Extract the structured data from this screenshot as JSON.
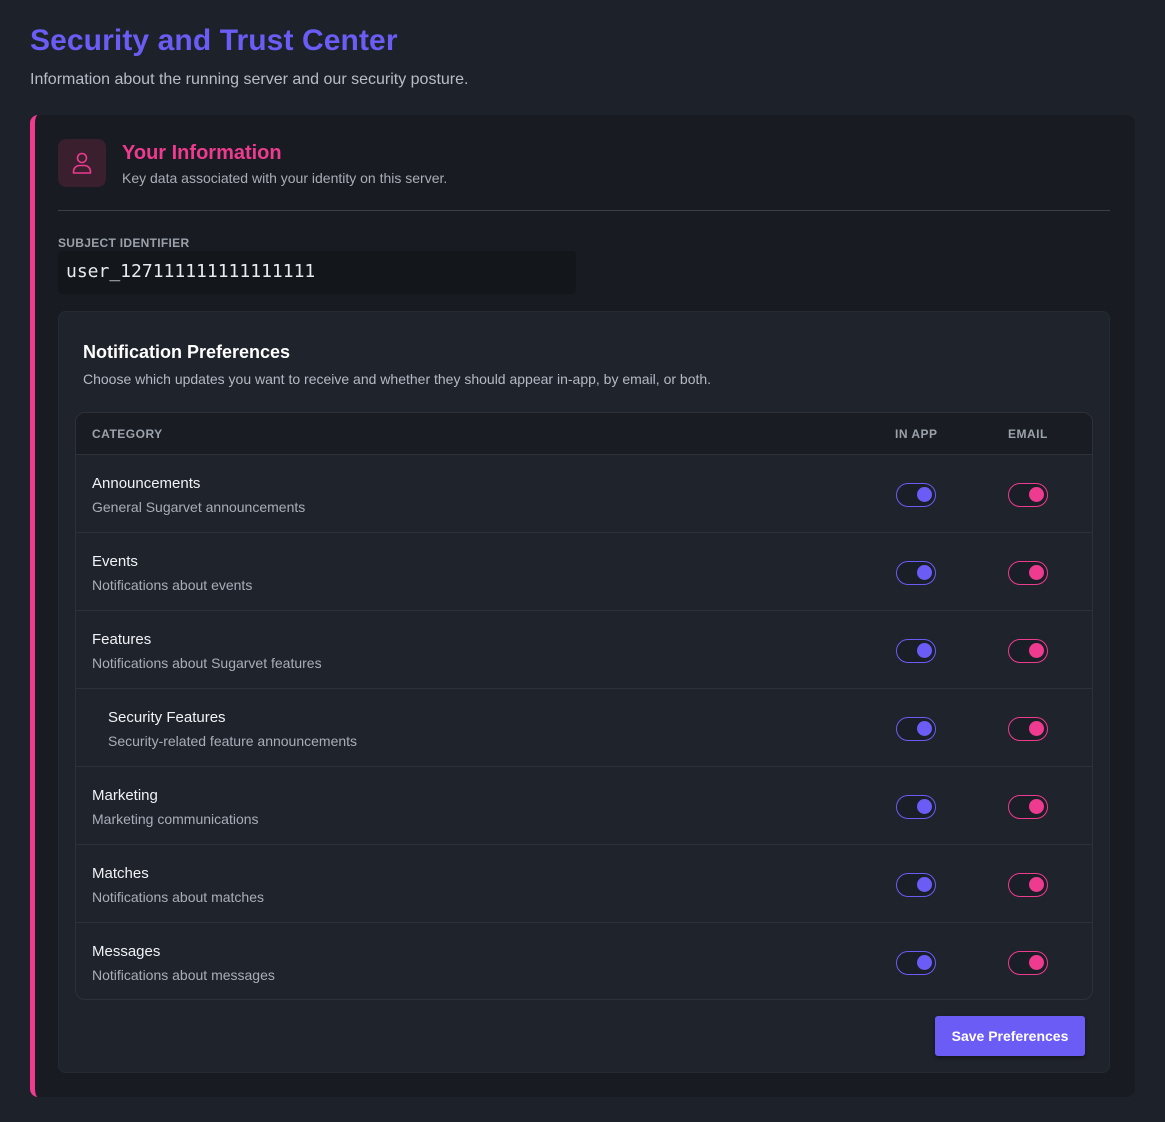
{
  "page": {
    "title": "Security and Trust Center",
    "subtitle": "Information about the running server and our security posture."
  },
  "your_info": {
    "title": "Your Information",
    "subtitle": "Key data associated with your identity on this server.",
    "icon": "user-icon",
    "subject_label": "SUBJECT IDENTIFIER",
    "subject_value": "user_127111111111111111"
  },
  "notifications": {
    "title": "Notification Preferences",
    "subtitle": "Choose which updates you want to receive and whether they should appear in-app, by email, or both.",
    "columns": {
      "category": "CATEGORY",
      "in_app": "IN APP",
      "email": "EMAIL"
    },
    "rows": [
      {
        "title": "Announcements",
        "description": "General Sugarvet announcements",
        "in_app": true,
        "email": true,
        "child": false
      },
      {
        "title": "Events",
        "description": "Notifications about events",
        "in_app": true,
        "email": true,
        "child": false
      },
      {
        "title": "Features",
        "description": "Notifications about Sugarvet features",
        "in_app": true,
        "email": true,
        "child": false
      },
      {
        "title": "Security Features",
        "description": "Security-related feature announcements",
        "in_app": true,
        "email": true,
        "child": true
      },
      {
        "title": "Marketing",
        "description": "Marketing communications",
        "in_app": true,
        "email": true,
        "child": false
      },
      {
        "title": "Matches",
        "description": "Notifications about matches",
        "in_app": true,
        "email": true,
        "child": false
      },
      {
        "title": "Messages",
        "description": "Notifications about messages",
        "in_app": true,
        "email": true,
        "child": false
      }
    ],
    "save_label": "Save Preferences"
  },
  "colors": {
    "accent_primary": "#6a5cf5",
    "accent_secondary": "#ee3a8f",
    "background": "#1d222a"
  }
}
